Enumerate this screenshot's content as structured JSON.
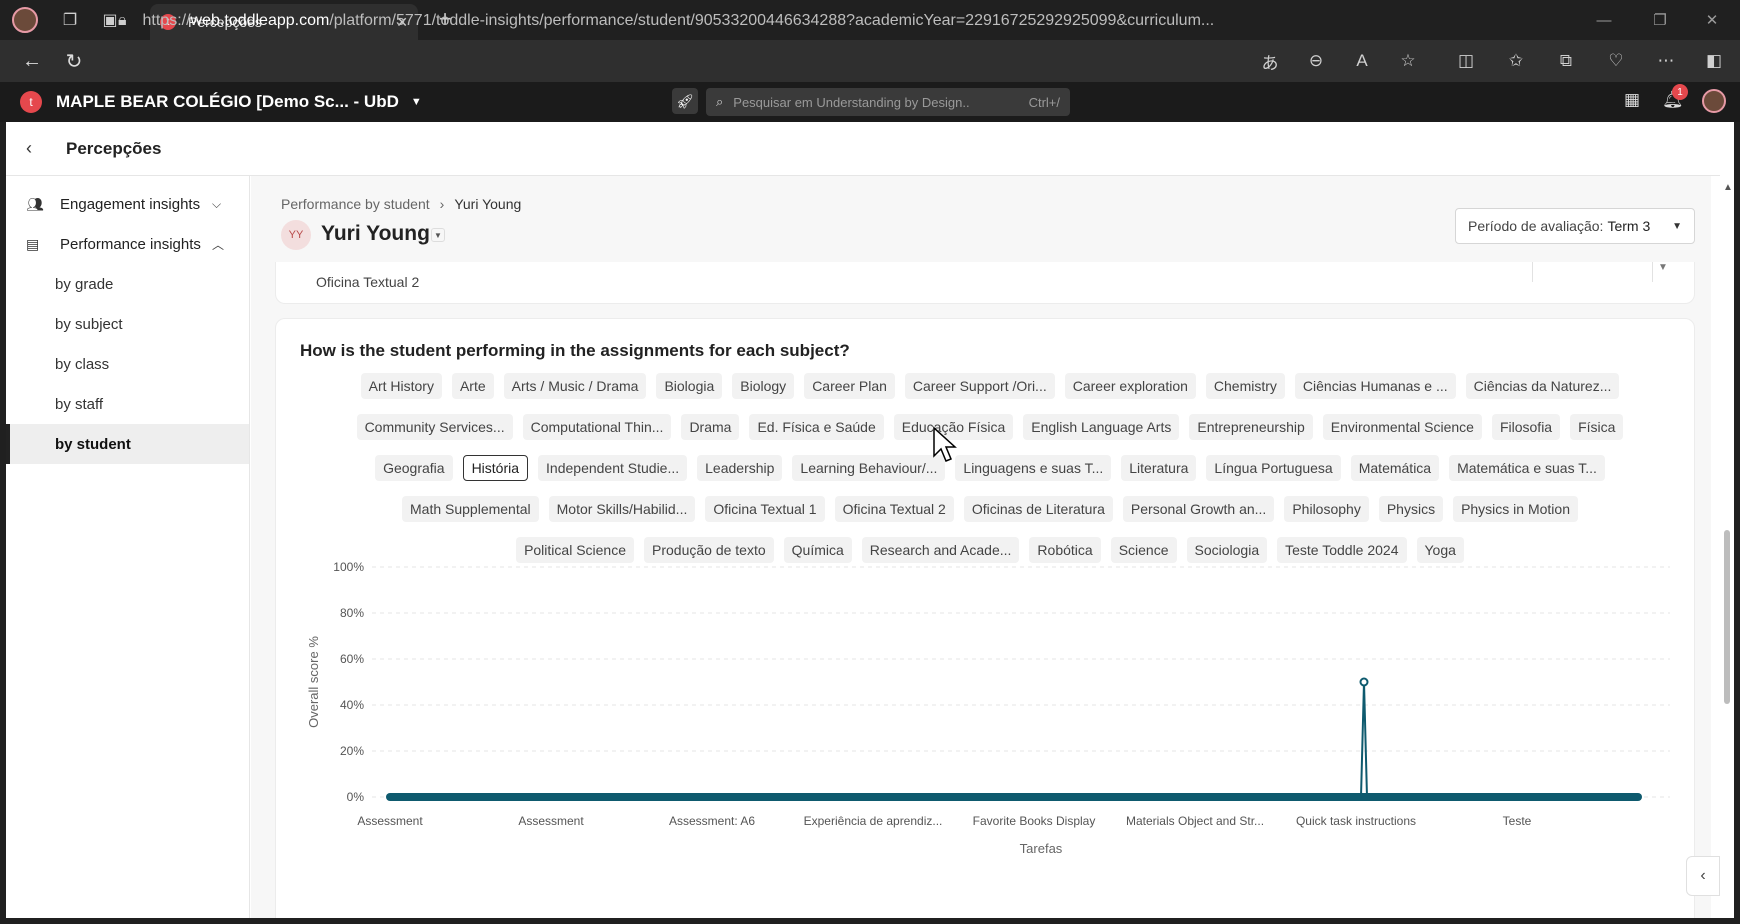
{
  "browser": {
    "tab_title": "Percepções",
    "url_prefix": "https://",
    "url_host": "web.toddleapp.com",
    "url_path": "/platform/5771/toddle-insights/performance/student/90533200446634288?academicYear=22916725292925099&curriculum...",
    "new_tab_icon": "+"
  },
  "app": {
    "school_name": "MAPLE BEAR COLÉGIO [Demo Sc... - UbD",
    "search_placeholder": "Pesquisar em Understanding by Design..",
    "search_shortcut": "Ctrl+/",
    "notification_count": "1"
  },
  "subheader": {
    "title": "Percepções"
  },
  "sidebar": {
    "sections": [
      {
        "label": "Engagement insights",
        "expanded": false
      },
      {
        "label": "Performance insights",
        "expanded": true
      }
    ],
    "sub_items": [
      "by grade",
      "by subject",
      "by class",
      "by staff",
      "by student"
    ],
    "active": "by student"
  },
  "main": {
    "breadcrumb": [
      "Performance by student",
      "Yuri Young"
    ],
    "student_initials": "YY",
    "student_name": "Yuri Young",
    "period_label": "Período de avaliação:",
    "period_value": "Term 3",
    "clipped_text": "Oficina Textual 2",
    "question_title": "How is the student performing in the assignments for each subject?"
  },
  "subjects": [
    [
      "Art History",
      "Arte",
      "Arts / Music / Drama",
      "Biologia",
      "Biology",
      "Career Plan",
      "Career Support /Ori...",
      "Career exploration",
      "Chemistry",
      "Ciências Humanas e ...",
      "Ciências da Naturez..."
    ],
    [
      "Community Services...",
      "Computational Thin...",
      "Drama",
      "Ed. Física e Saúde",
      "Educação Física",
      "English Language Arts",
      "Entrepreneurship",
      "Environmental Science",
      "Filosofia",
      "Física"
    ],
    [
      "Geografia",
      "História",
      "Independent Studie...",
      "Leadership",
      "Learning Behaviour/...",
      "Linguagens e suas T...",
      "Literatura",
      "Língua Portuguesa",
      "Matemática",
      "Matemática e suas T..."
    ],
    [
      "Math Supplemental",
      "Motor Skills/Habilid...",
      "Oficina Textual 1",
      "Oficina Textual 2",
      "Oficinas de Literatura",
      "Personal Growth an...",
      "Philosophy",
      "Physics",
      "Physics in Motion"
    ],
    [
      "Political Science",
      "Produção de texto",
      "Química",
      "Research and Acade...",
      "Robótica",
      "Science",
      "Sociologia",
      "Teste Toddle 2024",
      "Yoga"
    ]
  ],
  "selected_subject": "História",
  "chart_data": {
    "type": "line",
    "title": "",
    "xlabel": "Tarefas",
    "ylabel": "Overall score %",
    "ylim": [
      0,
      100
    ],
    "yticks": [
      "100%",
      "80%",
      "60%",
      "40%",
      "20%",
      "0%"
    ],
    "x_tick_labels": [
      "Assessment",
      "Assessment",
      "Assessment: A6",
      "Experiência de aprendiz...",
      "Favorite Books Display",
      "Materials Object and Str...",
      "Quick task instructions",
      "Teste"
    ],
    "series": [
      {
        "color": "#0e5a6e",
        "spike_point": {
          "near_tick": "Quick task instructions",
          "y": 50
        },
        "baseline": 0
      }
    ],
    "grid": true
  },
  "colors": {
    "accent": "#0e5a6e",
    "brand_red": "#e5484d"
  }
}
